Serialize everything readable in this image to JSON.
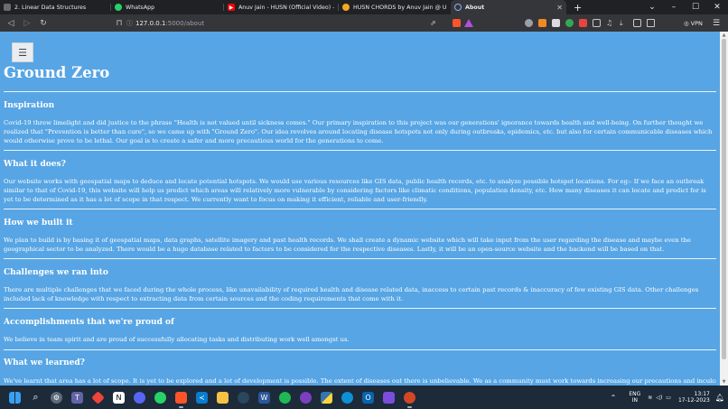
{
  "tabs": [
    {
      "label": "2. Linear Data Structures",
      "icon": "bookmark-icon",
      "color": "#6b6b6b"
    },
    {
      "label": "WhatsApp",
      "icon": "whatsapp-icon",
      "color": "#25d366"
    },
    {
      "label": "Anuv Jain - HUSN (Official Video) - Yo",
      "icon": "youtube-icon",
      "color": "#ff0000"
    },
    {
      "label": "HUSN CHORDS by Anuv Jain @ Ultim",
      "icon": "ultimate-guitar-icon",
      "color": "#f5a623"
    },
    {
      "label": "About",
      "icon": "globe-icon",
      "color": "#8ab4f8"
    }
  ],
  "address": {
    "host": "127.0.0.1",
    "path": ":5000/about"
  },
  "toolbar": {
    "vpn_label": "VPN"
  },
  "page": {
    "menu_glyph": "☰",
    "title": "Ground Zero",
    "sections": [
      {
        "heading": "Inspiration",
        "body": "Covid-19 threw limelight and did justice to the phrase \"Health is not valued until sickness comes.\" Our primary inspiration to this project was our generations' ignorance towards health and well-being. On further thought we realized that \"Prevention is better than cure\", so we came up with \"Ground Zero\". Our idea revolves around locating disease hotspots not only during outbreaks, epidemics, etc. but also for certain communicable diseases which would otherwise prove to be lethal. Our goal is to create a safer and more precautious world for the generations to come."
      },
      {
        "heading": "What it does?",
        "body": "Our website works with geospatial maps to deduce and locate potential hotspots. We would use various resources like GIS data, public health records, etc. to analyze possible hotspot locations. For eg:- If we face an outbreak similar to that of Covid-19, this website will help us predict which areas will relatively more vulnerable by considering factors like climatic conditions, population density, etc. How many diseases it can locate and predict for is yet to be determined as it has a lot of scope in that respect. We currently want to focus on making it efficient, reliable and user-friendly."
      },
      {
        "heading": "How we built it",
        "body": "We plan to build is by basing it of geospatial maps, data graphs, satellite imagery and past health records. We shall create a dynamic website which will take input from the user regarding the disease and maybe even the geographical sector to be analyzed. There would be a huge database related to factors to be considered for the respective diseases. Lastly, it will be an open-source website and the backend will be based on that."
      },
      {
        "heading": "Challenges we ran into",
        "body": "There are multiple challenges that we faced during the whole process, like unavailability of required health and disease related data, inaccess to certain past records & inaccuracy of few existing GIS data. Other challenges included lack of knowledge with respect to extracting data from certain sources and the coding requirements that come with it."
      },
      {
        "heading": "Accomplishments that we're proud of",
        "body": "We believe in team spirit and are proud of successfully allocating tasks and distributing work well amongst us."
      },
      {
        "heading": "What we learned?",
        "body": "We've learnt that area has a lot of scope. It is yet to be explored and a lot of development is possible. The extent of diseases out there is unbelievable. We as a community must work towards increasing our precautions and inculcating"
      }
    ]
  },
  "taskbar": {
    "apps": [
      {
        "icon": "windows-start-icon",
        "color": "#3a9ff0"
      },
      {
        "icon": "search-icon",
        "color": "transparent"
      },
      {
        "icon": "settings-icon",
        "color": "#5d6b7a"
      },
      {
        "icon": "teams-icon",
        "color": "#6264a7"
      },
      {
        "icon": "anydesk-icon",
        "color": "#ef443b"
      },
      {
        "icon": "notion-icon",
        "color": "#ffffff"
      },
      {
        "icon": "discord-icon",
        "color": "#5865f2"
      },
      {
        "icon": "whatsapp-icon",
        "color": "#25d366"
      },
      {
        "icon": "brave-icon",
        "color": "#fb542b"
      },
      {
        "icon": "vscode-icon",
        "color": "#0a7ccf"
      },
      {
        "icon": "file-explorer-icon",
        "color": "#f6c244"
      },
      {
        "icon": "steam-icon",
        "color": "#2a475e"
      },
      {
        "icon": "word-icon",
        "color": "#2b579a"
      },
      {
        "icon": "spotify-icon",
        "color": "#1db954"
      },
      {
        "icon": "github-desktop-icon",
        "color": "#7b3fbf"
      },
      {
        "icon": "python-icon",
        "color": "#d8b638"
      },
      {
        "icon": "edge-icon",
        "color": "#0f8fd6"
      },
      {
        "icon": "outlook-icon",
        "color": "#0a64ad"
      },
      {
        "icon": "obsidian-icon",
        "color": "#7c4ddb"
      },
      {
        "icon": "powerpoint-icon",
        "color": "#d24726"
      }
    ],
    "lang_top": "ENG",
    "lang_bottom": "IN",
    "time": "13:17",
    "date": "17-12-2023"
  }
}
